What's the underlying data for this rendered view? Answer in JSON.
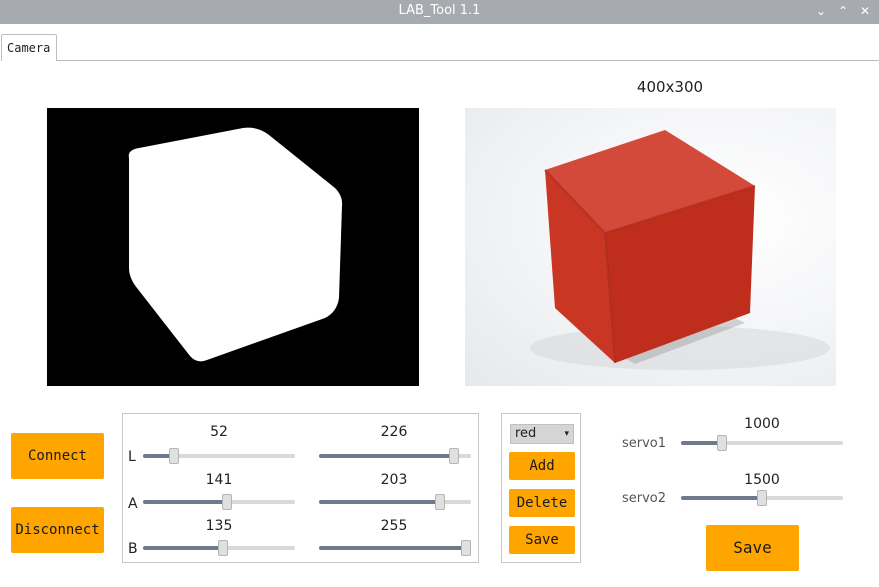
{
  "window": {
    "title": "LAB_Tool 1.1"
  },
  "titlebar_buttons": [
    {
      "icon": "chevron-down-icon",
      "glyph": "⌄"
    },
    {
      "icon": "chevron-up-icon",
      "glyph": "⌃"
    },
    {
      "icon": "close-icon",
      "glyph": "✕"
    }
  ],
  "tabs": [
    {
      "label": "Camera",
      "active": true
    }
  ],
  "camera": {
    "resolution": "400x300"
  },
  "buttons": {
    "connect": "Connect",
    "disconnect": "Disconnect",
    "add": "Add",
    "delete": "Delete",
    "save_color": "Save",
    "save_servo": "Save"
  },
  "lab": {
    "range": [
      0,
      255
    ],
    "channels": [
      {
        "label": "L",
        "min": 52,
        "max": 226
      },
      {
        "label": "A",
        "min": 141,
        "max": 203
      },
      {
        "label": "B",
        "min": 135,
        "max": 255
      }
    ]
  },
  "color_select": {
    "selected": "red"
  },
  "servos": {
    "range": [
      500,
      2500
    ],
    "items": [
      {
        "label": "servo1",
        "value": 1000
      },
      {
        "label": "servo2",
        "value": 1500
      }
    ]
  },
  "colors": {
    "button": "#ffa500",
    "titlebar": "#a7abb0",
    "slider_fill": "#6d7b8d"
  }
}
